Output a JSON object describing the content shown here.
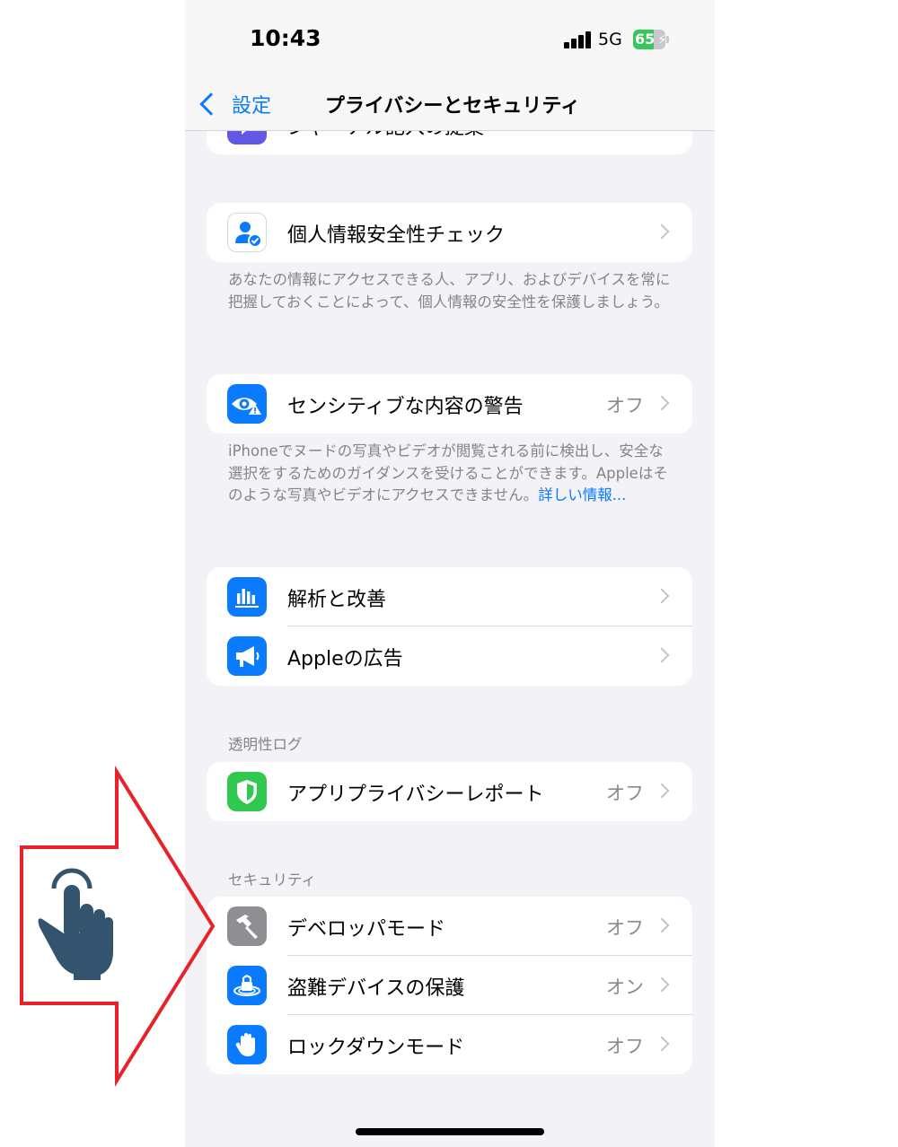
{
  "status_bar": {
    "time": "10:43",
    "network": "5G",
    "battery": "65",
    "battery_level": 0.65
  },
  "nav": {
    "back_label": "設定",
    "title": "プライバシーとセキュリティ"
  },
  "top_card": {
    "label": "ジャーナル記入の提案"
  },
  "safety_check": {
    "label": "個人情報安全性チェック",
    "footer": "あなたの情報にアクセスできる人、アプリ、およびデバイスを常に把握しておくことによって、個人情報の安全性を保護しましょう。"
  },
  "sensitive": {
    "label": "センシティブな内容の警告",
    "value": "オフ",
    "footer_text": "iPhoneでヌードの写真やビデオが閲覧される前に検出し、安全な選択をするためのガイダンスを受けることができます。Appleはそのような写真やビデオにアクセスできません。",
    "footer_link": "詳しい情報..."
  },
  "analytics_group": [
    {
      "label": "解析と改善"
    },
    {
      "label": "Appleの広告"
    }
  ],
  "transparency": {
    "header": "透明性ログ",
    "label": "アプリプライバシーレポート",
    "value": "オフ"
  },
  "security": {
    "header": "セキュリティ",
    "items": [
      {
        "label": "デベロッパモード",
        "value": "オフ"
      },
      {
        "label": "盗難デバイスの保護",
        "value": "オン"
      },
      {
        "label": "ロックダウンモード",
        "value": "オフ"
      }
    ]
  },
  "colors": {
    "accent": "#0a7aff",
    "annotation_arrow": "#e8222a",
    "hand_icon": "#34536f",
    "report_icon": "#30c84f",
    "purple_icon": "#6357e6",
    "gray_icon": "#8e8e93"
  },
  "annotation": {
    "pointer_icon": "tap-hand-icon",
    "arrow_icon": "red-arrow-outline"
  }
}
